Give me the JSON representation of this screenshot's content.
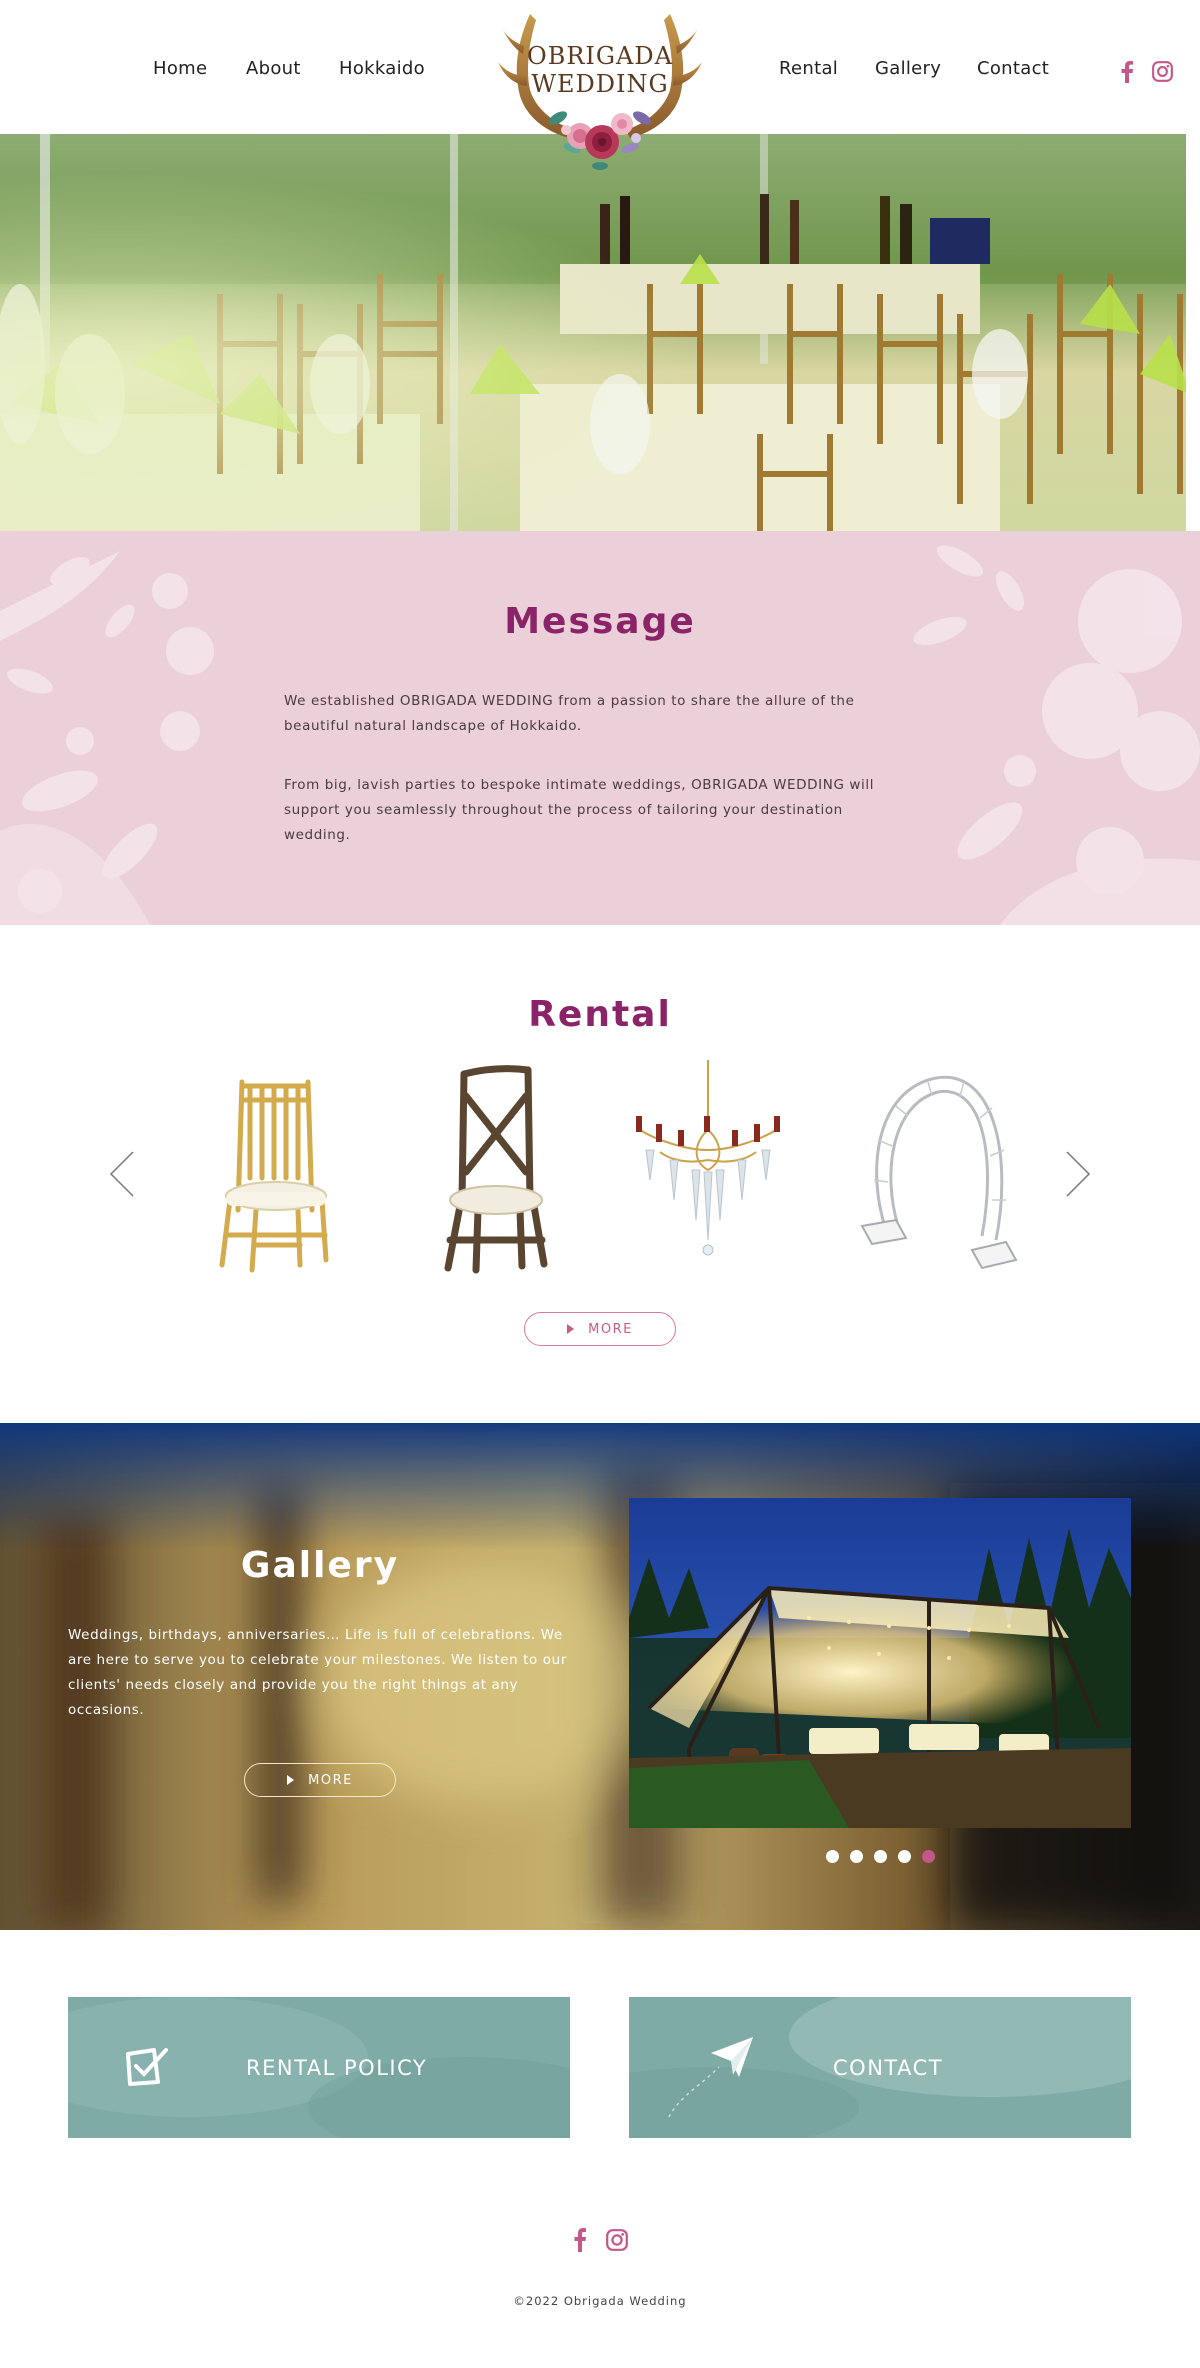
{
  "brand": {
    "name_line1": "OBRIGADA",
    "name_line2": "WEDDING"
  },
  "nav": {
    "left": [
      "Home",
      "About",
      "Hokkaido"
    ],
    "right": [
      "Rental",
      "Gallery",
      "Contact"
    ]
  },
  "social": {
    "icons": [
      "facebook-icon",
      "instagram-icon"
    ],
    "color": "#c2578a"
  },
  "message": {
    "title": "Message",
    "paragraphs": [
      "We established OBRIGADA WEDDING from a passion to share the allure of the beautiful natural landscape of Hokkaido.",
      "From big, lavish parties to bespoke intimate weddings, OBRIGADA WEDDING will support you seamlessly throughout the process of tailoring your destination wedding."
    ],
    "background": "#ebd0d9",
    "title_color": "#8a2367"
  },
  "rental": {
    "title": "Rental",
    "items": [
      "gold chiavari chair",
      "wooden cross-back chair",
      "crystal chandelier",
      "white circle arch"
    ],
    "more_label": "MORE"
  },
  "gallery": {
    "title": "Gallery",
    "text": "Weddings, birthdays, anniversaries… Life is full of celebrations. We are here to serve you to celebrate your milestones. We listen to our clients' needs closely and provide you the right things at any occasions.",
    "more_label": "MORE",
    "slide_count": 5,
    "active_slide": 5,
    "active_dot_color": "#c2578a"
  },
  "cards": {
    "rental_policy": "RENTAL POLICY",
    "contact": "CONTACT",
    "color": "#7faba6"
  },
  "footer": {
    "copyright": "©2022 Obrigada Wedding"
  }
}
